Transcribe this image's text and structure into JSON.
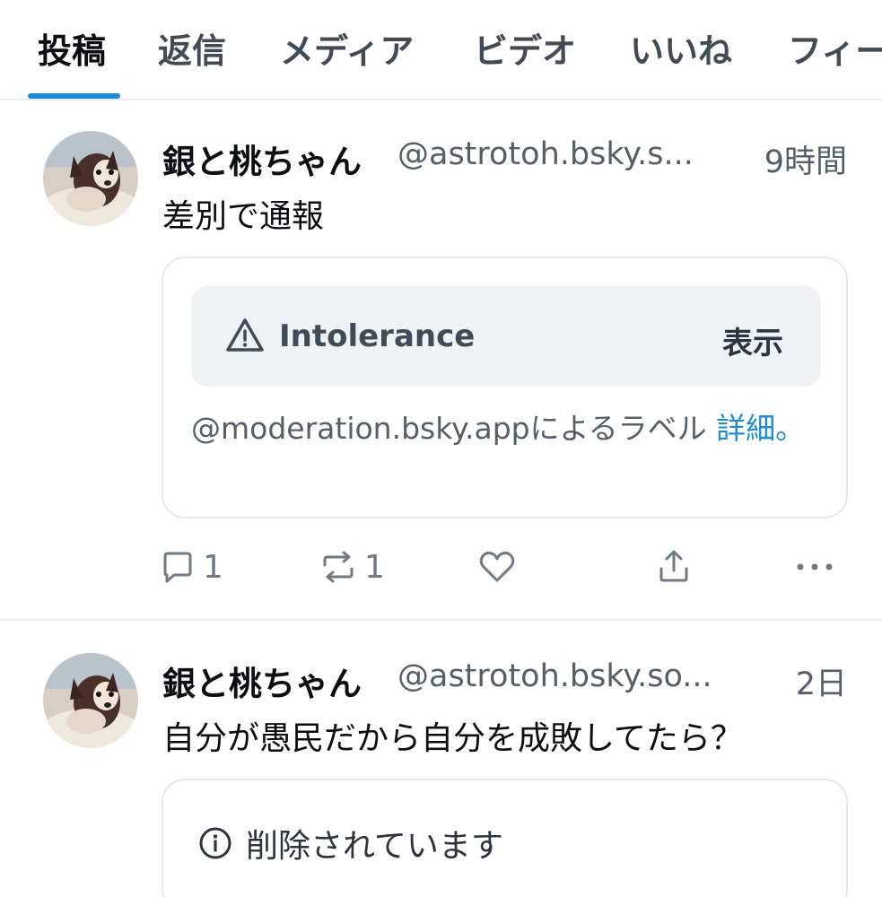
{
  "tabs": [
    {
      "label": "投稿",
      "active": true
    },
    {
      "label": "返信",
      "active": false
    },
    {
      "label": "メディア",
      "active": false
    },
    {
      "label": "ビデオ",
      "active": false
    },
    {
      "label": "いいね",
      "active": false
    },
    {
      "label": "フィー",
      "active": false
    }
  ],
  "posts": [
    {
      "author_name": "銀と桃ちゃん",
      "handle": "@astrotoh.bsky.s...",
      "time": "9時間",
      "text": "差別で通報",
      "moderation": {
        "icon": "warning-triangle-icon",
        "label": "Intolerance",
        "show_label": "表示",
        "note": "@moderation.bsky.appによるラベル",
        "link": "詳細。"
      },
      "actions": {
        "reply_count": "1",
        "repost_count": "1"
      }
    },
    {
      "author_name": "銀と桃ちゃん",
      "handle": "@astrotoh.bsky.so...",
      "time": "2日",
      "text": "自分が愚民だから自分を成敗してたら？",
      "quote": {
        "icon": "info-circle-icon",
        "text": "削除されています"
      }
    }
  ],
  "colors": {
    "accent": "#1a8cd8",
    "muted_text": "#545f6c",
    "icon_gray": "#6f7a86",
    "card_bg": "#f0f3f6",
    "border": "#e4e9ee"
  }
}
